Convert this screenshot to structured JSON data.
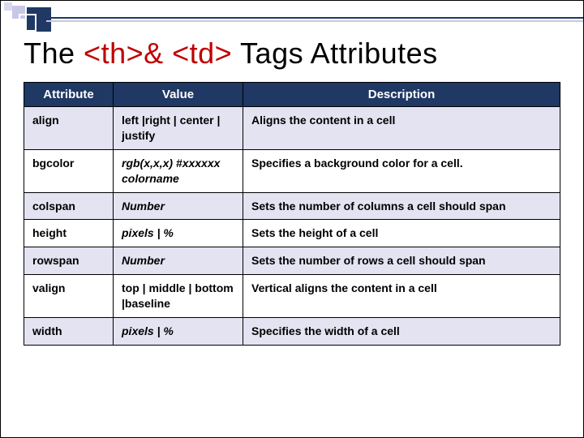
{
  "title": {
    "prefix": "The ",
    "tags": "<th>& <td>",
    "suffix": " Tags Attributes"
  },
  "columns": [
    "Attribute",
    "Value",
    "Description"
  ],
  "rows": [
    {
      "attr": "align",
      "value_plain": "left |right | center | justify",
      "value_italic": "",
      "desc": "Aligns the content in a cell"
    },
    {
      "attr": "bgcolor",
      "value_plain": "",
      "value_italic": "rgb(x,x,x) #xxxxxx colorname",
      "desc": "Specifies a background color for a cell."
    },
    {
      "attr": "colspan",
      "value_plain": "",
      "value_italic": "Number",
      "desc": "Sets the number of columns a cell should span"
    },
    {
      "attr": "height",
      "value_plain": "",
      "value_italic": "pixels | %",
      "desc": "Sets the height of a cell"
    },
    {
      "attr": "rowspan",
      "value_plain": "",
      "value_italic": "Number",
      "desc": "Sets the number of rows a cell should span"
    },
    {
      "attr": "valign",
      "value_plain": "top | middle | bottom |baseline",
      "value_italic": "",
      "desc": "Vertical aligns the content in a cell"
    },
    {
      "attr": "width",
      "value_plain": "",
      "value_italic": "pixels | %",
      "desc": "Specifies the width of a cell"
    }
  ]
}
